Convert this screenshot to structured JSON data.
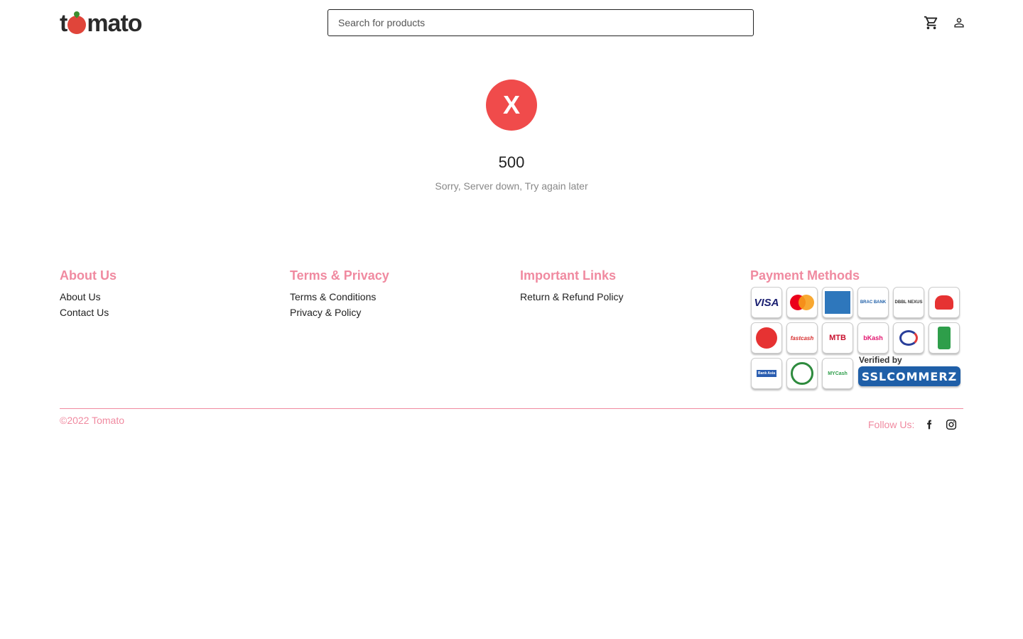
{
  "header": {
    "logo_text": "tomato",
    "search": {
      "placeholder": "Search for products",
      "value": ""
    },
    "icons": [
      "cart-icon",
      "user-icon"
    ]
  },
  "error": {
    "badge": "X",
    "code": "500",
    "message": "Sorry, Server down, Try again later"
  },
  "footer": {
    "about": {
      "heading": "About Us",
      "links": [
        "About Us",
        "Contact Us"
      ]
    },
    "terms": {
      "heading": "Terms & Privacy",
      "links": [
        "Terms & Conditions",
        "Privacy & Policy"
      ]
    },
    "important": {
      "heading": "Important Links",
      "links": [
        "Return & Refund Policy"
      ]
    },
    "payment": {
      "heading": "Payment Methods",
      "methods": [
        "VISA",
        "MasterCard",
        "AMERICAN EXPRESS",
        "BRAC BANK",
        "DBBL NEXUS",
        "CityTouch",
        "Q Cash",
        "fastcash",
        "MTB",
        "bKash",
        "MCash",
        "Sure Cash",
        "Bank Asia",
        "Upay",
        "MYCash"
      ],
      "verified_label": "Verified by",
      "verified_brand": "SSLCOMMERZ"
    },
    "copyright": "©2022 Tomato",
    "follow_label": "Follow Us:",
    "social_icons": [
      "facebook-icon",
      "instagram-icon"
    ]
  },
  "colors": {
    "accent": "#f08aa0",
    "error": "#f04b4b",
    "brand_red": "#e0453a",
    "ssl_blue": "#1f5fa8"
  }
}
